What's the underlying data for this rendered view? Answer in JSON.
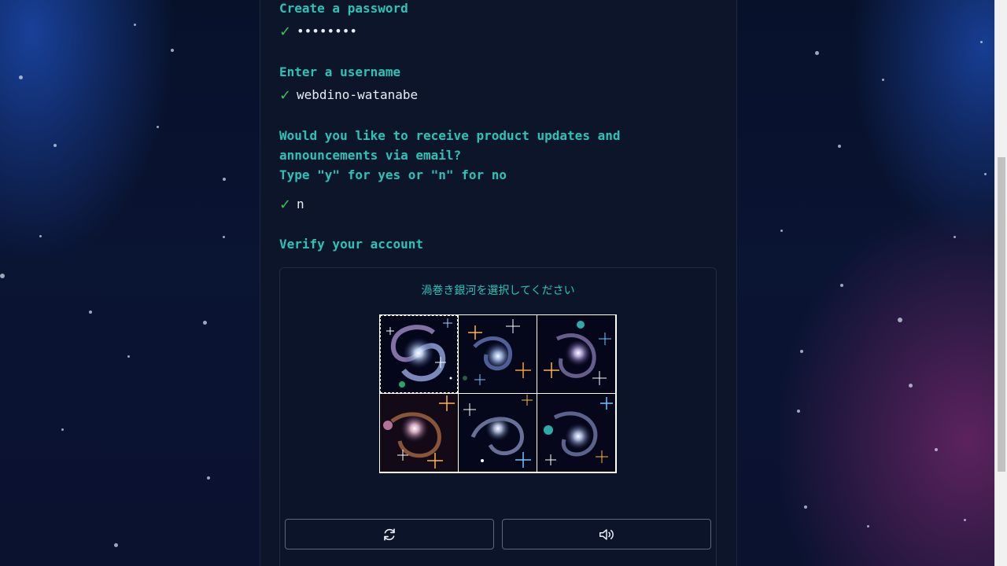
{
  "form": {
    "password": {
      "prompt": "Create a password",
      "value": "••••••••"
    },
    "username": {
      "prompt": "Enter a username",
      "value": "webdino-watanabe"
    },
    "updates": {
      "prompt_line1": "Would you like to receive product updates and",
      "prompt_line2": "announcements via email?",
      "prompt_line3": "Type \"y\" for yes or \"n\" for no",
      "value": "n"
    },
    "verify": {
      "prompt": "Verify your account"
    }
  },
  "captcha": {
    "instruction": "渦巻き銀河を選択してください",
    "tiles": [
      {
        "icon": "spiral-galaxy-image"
      },
      {
        "icon": "galaxy-image"
      },
      {
        "icon": "galaxy-image"
      },
      {
        "icon": "galaxy-image"
      },
      {
        "icon": "galaxy-image"
      },
      {
        "icon": "galaxy-image"
      }
    ],
    "refresh_icon": "refresh-icon",
    "audio_icon": "speaker-icon"
  },
  "colors": {
    "prompt": "#2bc3b6",
    "check": "#3ec04f",
    "panel_bg": "#0d152b",
    "page_bg": "#050b1a"
  }
}
